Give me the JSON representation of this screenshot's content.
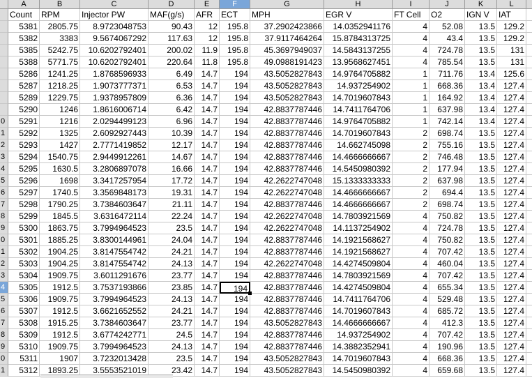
{
  "columns": [
    {
      "letter": "A",
      "selected": false
    },
    {
      "letter": "B",
      "selected": false
    },
    {
      "letter": "C",
      "selected": false
    },
    {
      "letter": "D",
      "selected": false
    },
    {
      "letter": "E",
      "selected": false
    },
    {
      "letter": "F",
      "selected": true
    },
    {
      "letter": "G",
      "selected": false
    },
    {
      "letter": "H",
      "selected": false
    },
    {
      "letter": "I",
      "selected": false
    },
    {
      "letter": "J",
      "selected": false
    },
    {
      "letter": "K",
      "selected": false
    },
    {
      "letter": "L",
      "selected": false
    },
    {
      "letter": "K",
      "selected": false
    }
  ],
  "header_row": [
    "Count",
    "RPM",
    "Injector PW",
    "MAF(g/s)",
    "AFR",
    "ECT",
    "MPH",
    "EGR V",
    "FT Cell",
    "O2",
    "IGN V",
    "IAT"
  ],
  "active_cell": {
    "row_index": 23,
    "col_index": 5
  },
  "rows": [
    {
      "rh": "",
      "c": [
        "5381",
        "2805.75",
        "8.9723048753",
        "90.43",
        "12",
        "195.8",
        "37.2902423866",
        "14.0352941176",
        "4",
        "52.08",
        "13.5",
        "129.2"
      ]
    },
    {
      "rh": "",
      "c": [
        "5382",
        "3383",
        "9.5674067292",
        "117.63",
        "12",
        "195.8",
        "37.9117464264",
        "15.8784313725",
        "4",
        "43.4",
        "13.5",
        "129.2"
      ]
    },
    {
      "rh": "",
      "c": [
        "5385",
        "5242.75",
        "10.6202792401",
        "200.02",
        "11.9",
        "195.8",
        "45.3697949037",
        "14.5843137255",
        "4",
        "724.78",
        "13.5",
        "131"
      ]
    },
    {
      "rh": "",
      "c": [
        "5388",
        "5771.75",
        "10.6202792401",
        "220.64",
        "11.8",
        "195.8",
        "49.0988191423",
        "13.9568627451",
        "4",
        "785.54",
        "13.5",
        "131"
      ]
    },
    {
      "rh": "",
      "c": [
        "5286",
        "1241.25",
        "1.8768596933",
        "6.49",
        "14.7",
        "194",
        "43.5052827843",
        "14.9764705882",
        "1",
        "711.76",
        "13.4",
        "125.6"
      ]
    },
    {
      "rh": "",
      "c": [
        "5287",
        "1218.25",
        "1.9073777371",
        "6.53",
        "14.7",
        "194",
        "43.5052827843",
        "14.937254902",
        "1",
        "668.36",
        "13.4",
        "127.4"
      ]
    },
    {
      "rh": "",
      "c": [
        "5289",
        "1229.75",
        "1.9378957809",
        "6.36",
        "14.7",
        "194",
        "43.5052827843",
        "14.7019607843",
        "1",
        "164.92",
        "13.4",
        "127.4"
      ]
    },
    {
      "rh": "",
      "c": [
        "5290",
        "1246",
        "1.8616006714",
        "6.42",
        "14.7",
        "194",
        "42.8837787446",
        "14.7411764706",
        "1",
        "637.98",
        "13.4",
        "127.4"
      ]
    },
    {
      "rh": "0",
      "c": [
        "5291",
        "1216",
        "2.0294499123",
        "6.96",
        "14.7",
        "194",
        "42.8837787446",
        "14.9764705882",
        "1",
        "742.14",
        "13.4",
        "127.4"
      ]
    },
    {
      "rh": "1",
      "c": [
        "5292",
        "1325",
        "2.6092927443",
        "10.39",
        "14.7",
        "194",
        "42.8837787446",
        "14.7019607843",
        "2",
        "698.74",
        "13.5",
        "127.4"
      ]
    },
    {
      "rh": "2",
      "c": [
        "5293",
        "1427",
        "2.7771419852",
        "12.17",
        "14.7",
        "194",
        "42.8837787446",
        "14.662745098",
        "2",
        "755.16",
        "13.5",
        "127.4"
      ]
    },
    {
      "rh": "3",
      "c": [
        "5294",
        "1540.75",
        "2.9449912261",
        "14.67",
        "14.7",
        "194",
        "42.8837787446",
        "14.4666666667",
        "2",
        "746.48",
        "13.5",
        "127.4"
      ]
    },
    {
      "rh": "4",
      "c": [
        "5295",
        "1630.5",
        "3.2806897078",
        "16.66",
        "14.7",
        "194",
        "42.8837787446",
        "14.5450980392",
        "2",
        "177.94",
        "13.5",
        "127.4"
      ]
    },
    {
      "rh": "5",
      "c": [
        "5296",
        "1698",
        "3.3417257954",
        "17.72",
        "14.7",
        "194",
        "42.2622747048",
        "15.1333333333",
        "2",
        "637.98",
        "13.5",
        "127.4"
      ]
    },
    {
      "rh": "6",
      "c": [
        "5297",
        "1740.5",
        "3.3569848173",
        "19.31",
        "14.7",
        "194",
        "42.2622747048",
        "14.4666666667",
        "2",
        "694.4",
        "13.5",
        "127.4"
      ]
    },
    {
      "rh": "7",
      "c": [
        "5298",
        "1790.25",
        "3.7384603647",
        "21.11",
        "14.7",
        "194",
        "42.8837787446",
        "14.4666666667",
        "2",
        "698.74",
        "13.5",
        "127.4"
      ]
    },
    {
      "rh": "8",
      "c": [
        "5299",
        "1845.5",
        "3.6316472114",
        "22.24",
        "14.7",
        "194",
        "42.2622747048",
        "14.7803921569",
        "4",
        "750.82",
        "13.5",
        "127.4"
      ]
    },
    {
      "rh": "9",
      "c": [
        "5300",
        "1863.75",
        "3.7994964523",
        "23.5",
        "14.7",
        "194",
        "42.2622747048",
        "14.1137254902",
        "4",
        "724.78",
        "13.5",
        "127.4"
      ]
    },
    {
      "rh": "0",
      "c": [
        "5301",
        "1885.25",
        "3.8300144961",
        "24.04",
        "14.7",
        "194",
        "42.8837787446",
        "14.1921568627",
        "4",
        "750.82",
        "13.5",
        "127.4"
      ]
    },
    {
      "rh": "1",
      "c": [
        "5302",
        "1904.25",
        "3.8147554742",
        "24.21",
        "14.7",
        "194",
        "42.8837787446",
        "14.1921568627",
        "4",
        "707.42",
        "13.5",
        "127.4"
      ]
    },
    {
      "rh": "2",
      "c": [
        "5303",
        "1904.25",
        "3.8147554742",
        "24.13",
        "14.7",
        "194",
        "42.2622747048",
        "14.4274509804",
        "4",
        "460.04",
        "13.5",
        "127.4"
      ]
    },
    {
      "rh": "3",
      "c": [
        "5304",
        "1909.75",
        "3.6011291676",
        "23.77",
        "14.7",
        "194",
        "42.8837787446",
        "14.7803921569",
        "4",
        "707.42",
        "13.5",
        "127.4"
      ]
    },
    {
      "rh": "4",
      "c": [
        "5305",
        "1912.5",
        "3.7537193866",
        "23.85",
        "14.7",
        "194",
        "42.8837787446",
        "14.4274509804",
        "4",
        "655.34",
        "13.5",
        "127.4"
      ]
    },
    {
      "rh": "5",
      "c": [
        "5306",
        "1909.75",
        "3.7994964523",
        "24.13",
        "14.7",
        "194",
        "42.8837787446",
        "14.7411764706",
        "4",
        "529.48",
        "13.5",
        "127.4"
      ]
    },
    {
      "rh": "6",
      "c": [
        "5307",
        "1912.5",
        "3.6621652552",
        "24.21",
        "14.7",
        "194",
        "42.8837787446",
        "14.7019607843",
        "4",
        "685.72",
        "13.5",
        "127.4"
      ]
    },
    {
      "rh": "7",
      "c": [
        "5308",
        "1915.25",
        "3.7384603647",
        "23.77",
        "14.7",
        "194",
        "43.5052827843",
        "14.4666666667",
        "4",
        "412.3",
        "13.5",
        "127.4"
      ]
    },
    {
      "rh": "8",
      "c": [
        "5309",
        "1912.5",
        "3.6774242771",
        "24.5",
        "14.7",
        "194",
        "42.8837787446",
        "14.937254902",
        "4",
        "707.42",
        "13.5",
        "127.4"
      ]
    },
    {
      "rh": "9",
      "c": [
        "5310",
        "1909.75",
        "3.7994964523",
        "24.13",
        "14.7",
        "194",
        "42.8837787446",
        "14.3882352941",
        "4",
        "190.96",
        "13.5",
        "127.4"
      ]
    },
    {
      "rh": "0",
      "c": [
        "5311",
        "1907",
        "3.7232013428",
        "23.5",
        "14.7",
        "194",
        "43.5052827843",
        "14.7019607843",
        "4",
        "668.36",
        "13.5",
        "127.4"
      ]
    },
    {
      "rh": "1",
      "c": [
        "5312",
        "1893.25",
        "3.5553521019",
        "23.42",
        "14.7",
        "194",
        "43.5052827843",
        "14.5450980392",
        "4",
        "659.68",
        "13.5",
        "127.4"
      ]
    }
  ]
}
